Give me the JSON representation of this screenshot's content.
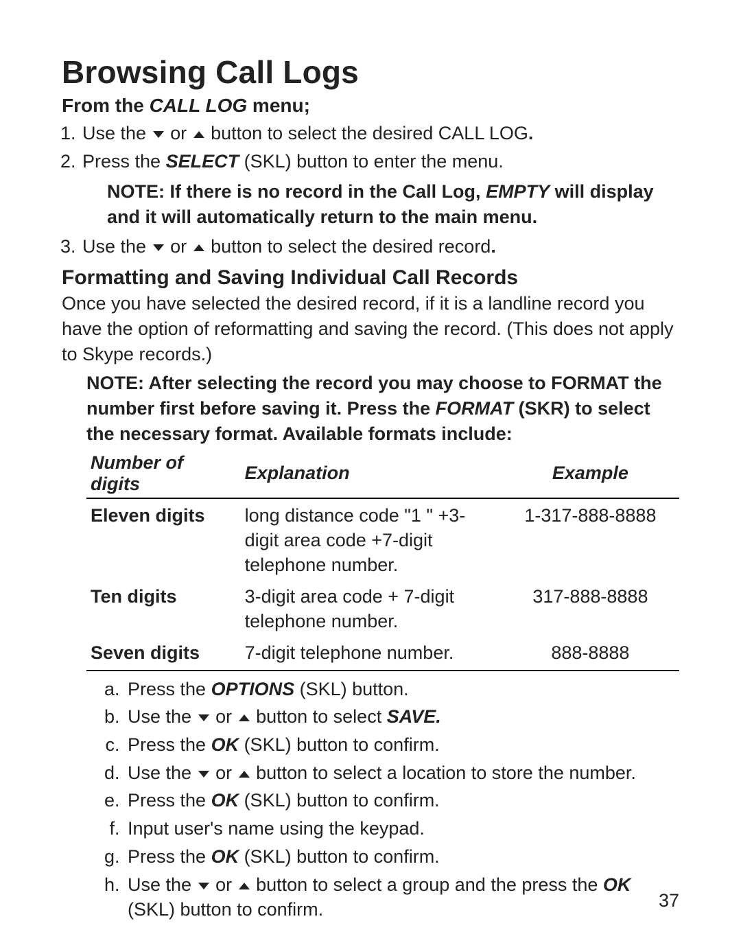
{
  "title": "Browsing Call Logs",
  "from_prefix": "From the ",
  "from_menu": "CALL LOG",
  "from_suffix": " menu;",
  "step1_a": "Use the ",
  "step1_or": " or ",
  "step1_b": " button to select the desired CALL LOG",
  "step1_dot": ".",
  "step2_a": "Press the ",
  "step2_select": "SELECT",
  "step2_b": " (SKL) button to enter the menu.",
  "note1_a": "NOTE: If there is no record in the Call Log, ",
  "note1_empty": "EMPTY",
  "note1_b": " will display and it will automatically return to the main menu.",
  "step3_a": "Use the ",
  "step3_or": " or ",
  "step3_b": " button to select the desired record",
  "step3_dot": ".",
  "section2_title": "Formatting and Saving Individual Call Records",
  "section2_para": "Once you have selected the desired record, if it is a landline record you have the option of reformatting and saving the record. (This does not apply to Skype records.)",
  "note2_a": "NOTE: After selecting the record you may choose to FORMAT the number first before saving it. Press the ",
  "note2_format": "FORMAT",
  "note2_b": " (SKR) to select the necessary format. Available formats include:",
  "table": {
    "headers": {
      "digits": "Number of digits",
      "explain": "Explanation",
      "example": "Example"
    },
    "rows": [
      {
        "digits": "Eleven digits",
        "explain": "long distance code \"1 \" +3-digit area code +7-digit telephone number.",
        "example": "1-317-888-8888"
      },
      {
        "digits": "Ten digits",
        "explain": "3-digit area code + 7-digit telephone number.",
        "example": "317-888-8888"
      },
      {
        "digits": "Seven digits",
        "explain": "7-digit telephone number.",
        "example": "888-8888"
      }
    ]
  },
  "letters": {
    "a_1": "Press the ",
    "a_options": "OPTIONS",
    "a_2": " (SKL) button.",
    "b_1": "Use the ",
    "b_or": " or ",
    "b_2": " button to select ",
    "b_save": "SAVE.",
    "c_1": "Press the ",
    "c_ok": "OK",
    "c_2": " (SKL) button to confirm.",
    "d_1": "Use the ",
    "d_or": " or ",
    "d_2": " button to select a location to store the number.",
    "e_1": "Press the ",
    "e_ok": "OK",
    "e_2": " (SKL) button to confirm.",
    "f": "Input user's name using the keypad.",
    "g_1": "Press the ",
    "g_ok": "OK",
    "g_2": " (SKL) button to confirm.",
    "h_1": "Use the ",
    "h_or": " or ",
    "h_2": " button to select a group and the press the ",
    "h_ok": "OK",
    "h_3": " (SKL) button to confirm."
  },
  "page_number": "37"
}
